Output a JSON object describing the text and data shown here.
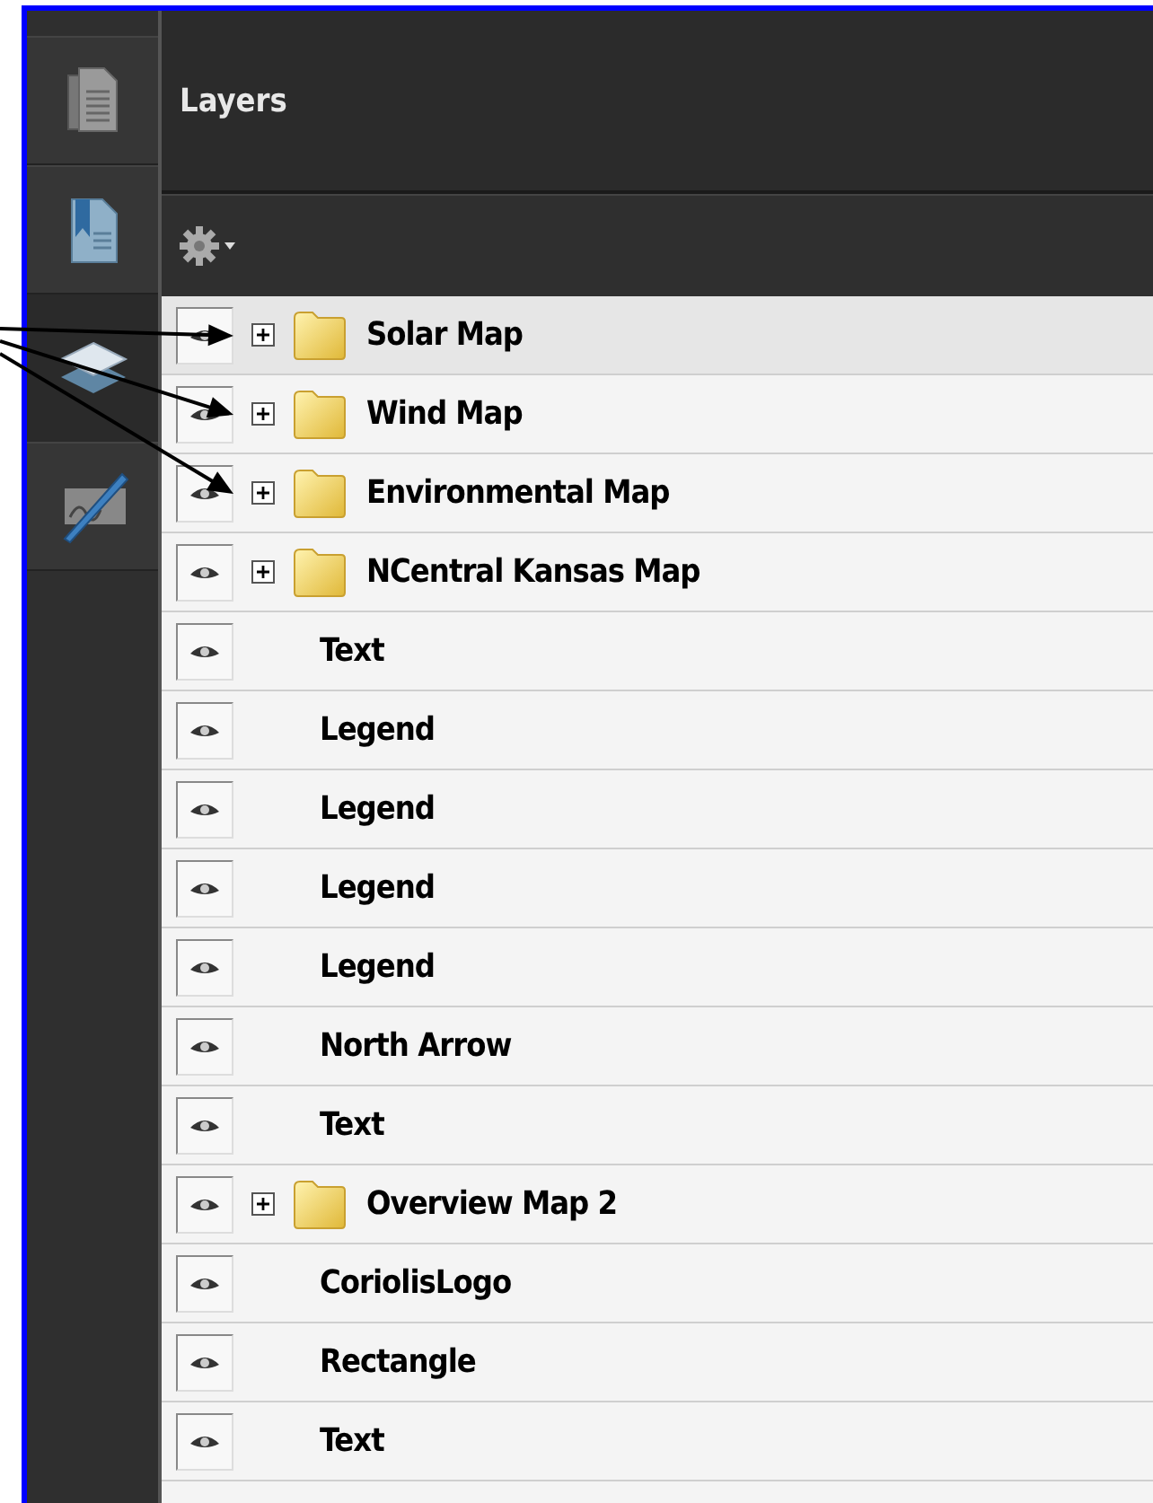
{
  "sidebar": {
    "items": [
      {
        "kind": "pages",
        "selected": false
      },
      {
        "kind": "bookmarks",
        "selected": false
      },
      {
        "kind": "layers",
        "selected": true
      },
      {
        "kind": "signature",
        "selected": false
      }
    ]
  },
  "panel": {
    "title": "Layers"
  },
  "layers": [
    {
      "name": "Solar Map",
      "kind": "group",
      "expanded": false,
      "visible": true,
      "selected": true,
      "callout_arrow": true
    },
    {
      "name": "Wind Map",
      "kind": "group",
      "expanded": false,
      "visible": true,
      "selected": false,
      "callout_arrow": true
    },
    {
      "name": "Environmental Map",
      "kind": "group",
      "expanded": false,
      "visible": true,
      "selected": false,
      "callout_arrow": true
    },
    {
      "name": "NCentral Kansas Map",
      "kind": "group",
      "expanded": false,
      "visible": true,
      "selected": false,
      "callout_arrow": false
    },
    {
      "name": "Text",
      "kind": "layer",
      "visible": true,
      "selected": false,
      "callout_arrow": false
    },
    {
      "name": "Legend",
      "kind": "layer",
      "visible": true,
      "selected": false,
      "callout_arrow": false
    },
    {
      "name": "Legend",
      "kind": "layer",
      "visible": true,
      "selected": false,
      "callout_arrow": false
    },
    {
      "name": "Legend",
      "kind": "layer",
      "visible": true,
      "selected": false,
      "callout_arrow": false
    },
    {
      "name": "Legend",
      "kind": "layer",
      "visible": true,
      "selected": false,
      "callout_arrow": false
    },
    {
      "name": "North Arrow",
      "kind": "layer",
      "visible": true,
      "selected": false,
      "callout_arrow": false
    },
    {
      "name": "Text",
      "kind": "layer",
      "visible": true,
      "selected": false,
      "callout_arrow": false
    },
    {
      "name": "Overview Map 2",
      "kind": "group",
      "expanded": false,
      "visible": true,
      "selected": false,
      "callout_arrow": false
    },
    {
      "name": "CoriolisLogo",
      "kind": "layer",
      "visible": true,
      "selected": false,
      "callout_arrow": false
    },
    {
      "name": "Rectangle",
      "kind": "layer",
      "visible": true,
      "selected": false,
      "callout_arrow": false
    },
    {
      "name": "Text",
      "kind": "layer",
      "visible": true,
      "selected": false,
      "callout_arrow": false
    }
  ]
}
